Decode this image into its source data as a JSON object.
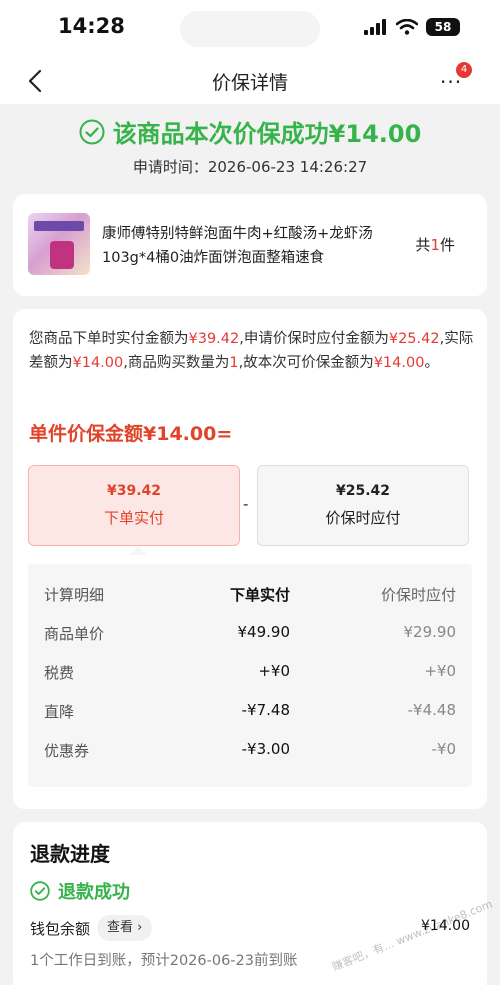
{
  "status_bar": {
    "time": "14:28",
    "battery": "58"
  },
  "nav": {
    "title": "价保详情",
    "badge_count": "4"
  },
  "header": {
    "success_text": "该商品本次价保成功¥14.00",
    "apply_time": "申请时间：2026-06-23 14:26:27",
    "success_color": "#36b34a"
  },
  "product": {
    "name": "康师傅特别特鲜泡面牛肉+红酸汤+龙虾汤103g*4桶0油炸面饼泡面整箱速食",
    "qty_prefix": "共",
    "qty_value": "1",
    "qty_suffix": "件"
  },
  "calc": {
    "p1": "您商品下单时实付金额为",
    "v1": "¥39.42",
    "p2": ",申请价保时应付金额为",
    "v2": "¥25.42",
    "p3": ",实际差额为",
    "v3": "¥14.00",
    "p4": ",商品购买数量为",
    "v4": "1",
    "p5": ",故本次可价保金额为",
    "v5": "¥14.00",
    "p6": "。",
    "unit_amount": "单件价保金额¥14.00=",
    "left_box": {
      "amount": "¥39.42",
      "label": "下单实付"
    },
    "minus": "-",
    "right_box": {
      "amount": "¥25.42",
      "label": "价保时应付"
    },
    "accent_color": "#e0442a"
  },
  "detail_table": {
    "headers": [
      "计算明细",
      "下单实付",
      "价保时应付"
    ],
    "rows": [
      [
        "商品单价",
        "¥49.90",
        "¥29.90"
      ],
      [
        "税费",
        "+¥0",
        "+¥0"
      ],
      [
        "直降",
        "-¥7.48",
        "-¥4.48"
      ],
      [
        "优惠券",
        "-¥3.00",
        "-¥0"
      ]
    ]
  },
  "refund": {
    "title": "退款进度",
    "status": "退款成功",
    "wallet_label": "钱包余额",
    "view_label": "查看",
    "amount": "¥14.00",
    "arrive_text": "1个工作日到账，预计2026-06-23前到账"
  },
  "watermark": "赚客吧，有... www.zuanke8.com"
}
